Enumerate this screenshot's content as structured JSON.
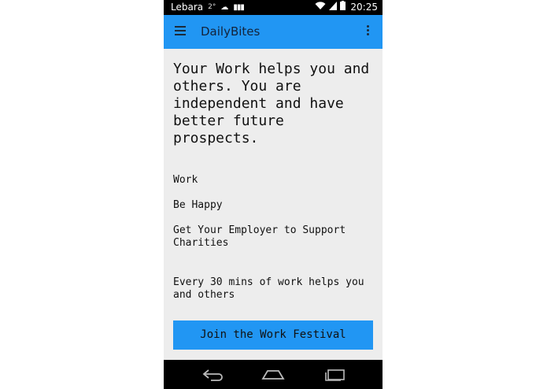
{
  "status_bar": {
    "carrier": "Lebara",
    "temperature": "2°",
    "time": "20:25"
  },
  "app_bar": {
    "title": "DailyBites"
  },
  "content": {
    "headline": "Your Work helps you and others. You are independent and have better future prospects.",
    "items": [
      "Work",
      "Be Happy",
      "Get Your Employer to Support Charities",
      "Every 30 mins of work helps you and others"
    ],
    "button_label": "Join the Work Festival"
  },
  "colors": {
    "accent": "#2196f3",
    "background": "#ededed",
    "bars": "#000000"
  }
}
